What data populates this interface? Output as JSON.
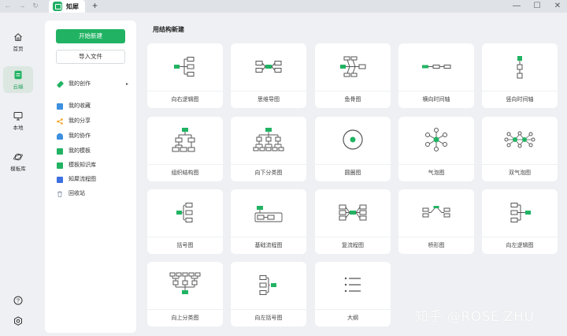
{
  "titlebar": {
    "tab_title": "知犀",
    "new_tab": "+",
    "back": "←",
    "forward": "→",
    "reload": "↻",
    "minimize": "—",
    "maximize": "☐",
    "close": "✕"
  },
  "rail": {
    "items": [
      {
        "label": "首页",
        "icon": "home-icon"
      },
      {
        "label": "云端",
        "icon": "cloud-doc-icon",
        "active": true
      },
      {
        "label": "本地",
        "icon": "monitor-icon"
      },
      {
        "label": "模板库",
        "icon": "planet-icon"
      }
    ],
    "bottom": [
      {
        "icon": "help-icon"
      },
      {
        "icon": "settings-icon"
      }
    ]
  },
  "sidebar": {
    "new_button": "开始新建",
    "import_button": "导入文件",
    "items": [
      {
        "label": "我的创作",
        "color": "#21b363",
        "arrow": "▸"
      },
      {
        "label": "我的收藏",
        "color": "#3d8fe0"
      },
      {
        "label": "我的分享",
        "color": "#f0a020"
      },
      {
        "label": "我的协作",
        "color": "#3d8fe0"
      },
      {
        "label": "我的模板",
        "color": "#21b363"
      },
      {
        "label": "模板知识库",
        "color": "#21b363"
      },
      {
        "label": "知犀流程图",
        "color": "#3d6fe0"
      },
      {
        "label": "回收站",
        "color": "#8a96a8"
      }
    ]
  },
  "main": {
    "section_title": "用结构新建",
    "cards": [
      {
        "label": "向右逻辑图",
        "icon": "logic-right-icon"
      },
      {
        "label": "思维导图",
        "icon": "mindmap-icon"
      },
      {
        "label": "鱼骨图",
        "icon": "fishbone-icon"
      },
      {
        "label": "横向时间轴",
        "icon": "timeline-horizontal-icon"
      },
      {
        "label": "竖向时间轴",
        "icon": "timeline-vertical-icon"
      },
      {
        "label": "组织结构图",
        "icon": "org-chart-icon"
      },
      {
        "label": "向下分类图",
        "icon": "tree-down-icon"
      },
      {
        "label": "圆圈图",
        "icon": "circle-map-icon"
      },
      {
        "label": "气泡图",
        "icon": "bubble-map-icon"
      },
      {
        "label": "双气泡图",
        "icon": "double-bubble-icon"
      },
      {
        "label": "括号图",
        "icon": "brace-map-icon"
      },
      {
        "label": "基础流程图",
        "icon": "basic-flow-icon"
      },
      {
        "label": "复流程图",
        "icon": "multi-flow-icon"
      },
      {
        "label": "桥形图",
        "icon": "bridge-map-icon"
      },
      {
        "label": "向左逻辑图",
        "icon": "logic-left-icon"
      },
      {
        "label": "向上分类图",
        "icon": "tree-up-icon"
      },
      {
        "label": "向左括号图",
        "icon": "brace-left-icon"
      },
      {
        "label": "大纲",
        "icon": "outline-icon"
      }
    ]
  },
  "watermark": "知乎 @ROSE ZHU",
  "colors": {
    "accent": "#21b363",
    "node_stroke": "#555555"
  }
}
